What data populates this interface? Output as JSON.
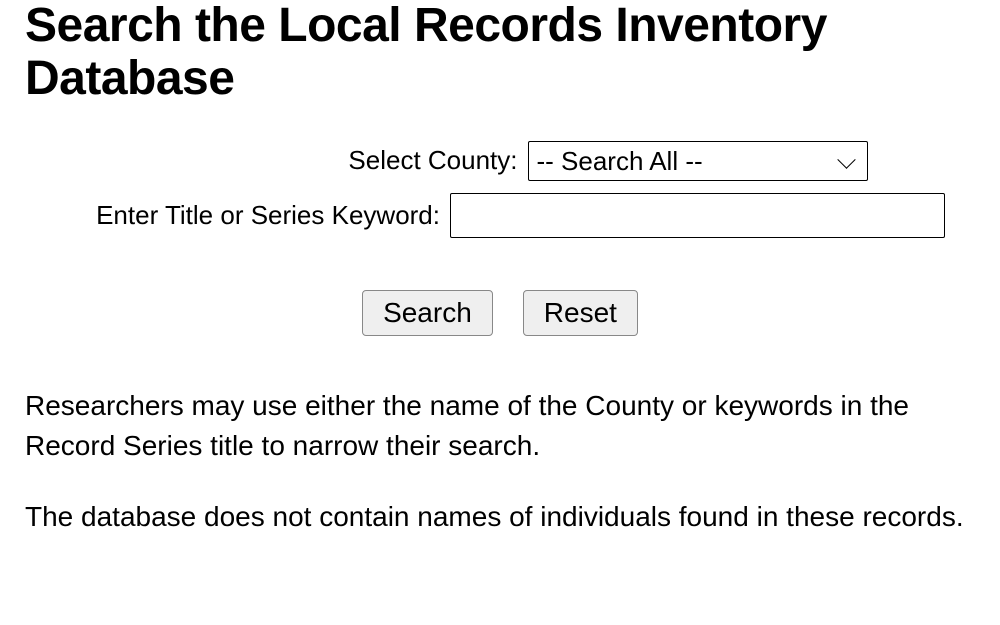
{
  "heading": "Search the Local Records Inventory Database",
  "form": {
    "county_label": "Select County:",
    "county_selected": "-- Search All --",
    "keyword_label": "Enter Title or Series Keyword:",
    "keyword_value": "",
    "search_button": "Search",
    "reset_button": "Reset"
  },
  "paragraphs": {
    "p1": "Researchers may use either the name of the County or keywords in the Record Series title to narrow their search.",
    "p2": "The database does not contain names of individuals found in these records."
  }
}
